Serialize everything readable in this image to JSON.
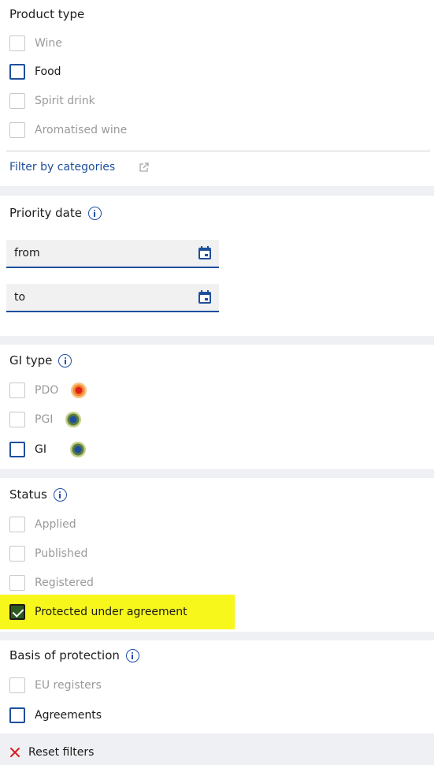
{
  "product_type": {
    "title": "Product type",
    "options": [
      {
        "label": "Wine",
        "state": "disabled"
      },
      {
        "label": "Food",
        "state": "unchecked"
      },
      {
        "label": "Spirit drink",
        "state": "disabled"
      },
      {
        "label": "Aromatised wine",
        "state": "disabled"
      }
    ],
    "filter_link": "Filter by categories"
  },
  "priority_date": {
    "title": "Priority date",
    "from_placeholder": "from",
    "to_placeholder": "to"
  },
  "gi_type": {
    "title": "GI type",
    "options": [
      {
        "label": "PDO",
        "state": "disabled",
        "badge_icon": "pdo-badge-icon"
      },
      {
        "label": "PGI",
        "state": "disabled",
        "badge_icon": "pgi-badge-icon"
      },
      {
        "label": "GI",
        "state": "unchecked",
        "badge_icon": "gi-badge-icon"
      }
    ]
  },
  "status": {
    "title": "Status",
    "options": [
      {
        "label": "Applied",
        "state": "disabled"
      },
      {
        "label": "Published",
        "state": "disabled"
      },
      {
        "label": "Registered",
        "state": "disabled"
      },
      {
        "label": "Protected under agreement",
        "state": "checked",
        "highlighted": true
      }
    ]
  },
  "basis_of_protection": {
    "title": "Basis of protection",
    "options": [
      {
        "label": "EU registers",
        "state": "disabled"
      },
      {
        "label": "Agreements",
        "state": "unchecked"
      }
    ]
  },
  "reset": {
    "label": "Reset filters"
  },
  "colors": {
    "accent": "#1e4f9c",
    "checked_fill": "#2c5a1e",
    "highlight": "#f7f71c",
    "reset_x": "#d42020"
  }
}
